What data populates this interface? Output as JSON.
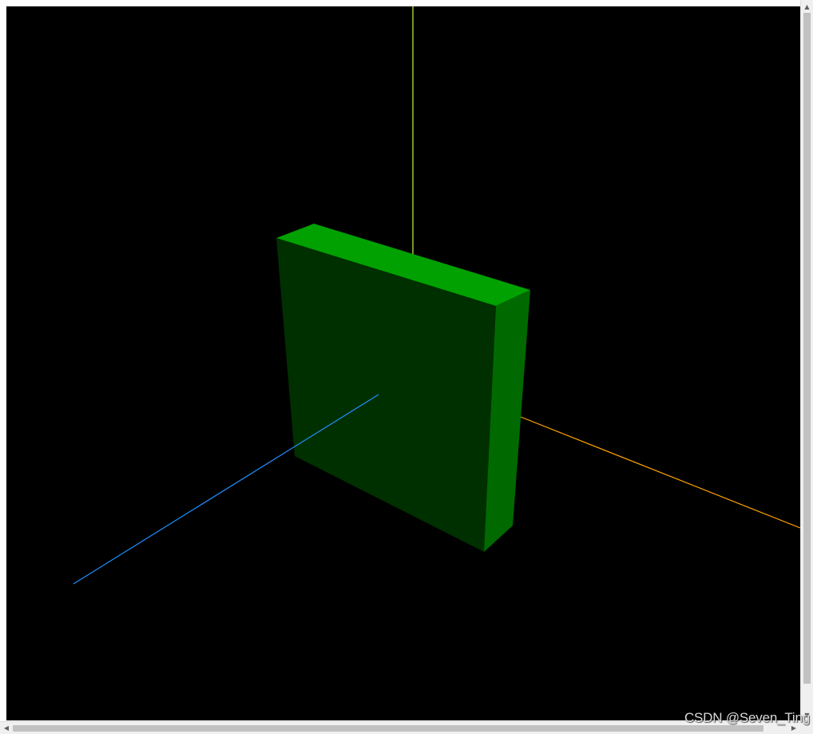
{
  "scene": {
    "background_color": "#000000",
    "axes": {
      "x_axis_color": "#ffa500",
      "y_axis_color": "#9acd32",
      "z_axis_color": "#1e90ff"
    },
    "box": {
      "front_face_color": "#002f00",
      "top_face_color": "#00a100",
      "side_face_color": "#006a00"
    }
  },
  "scrollbars": {
    "vertical": {
      "up_icon": "▲",
      "down_icon": "▼"
    },
    "horizontal": {
      "left_icon": "◀",
      "right_icon": "▶"
    }
  },
  "watermark": {
    "text": "CSDN @Seven_Ting"
  }
}
